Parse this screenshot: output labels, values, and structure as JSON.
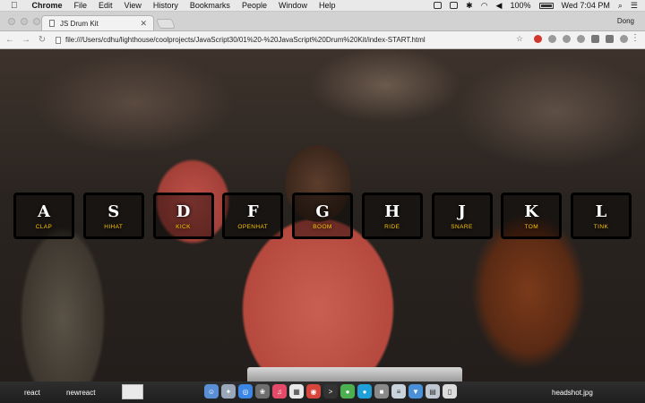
{
  "menubar": {
    "app_name": "Chrome",
    "items": [
      "File",
      "Edit",
      "View",
      "History",
      "Bookmarks",
      "People",
      "Window",
      "Help"
    ],
    "battery": "100%",
    "clock": "Wed 7:04 PM"
  },
  "browser": {
    "tab_title": "JS Drum Kit",
    "profile": "Dong",
    "url": "file:///Users/cdhu/lighthouse/coolprojects/JavaScript30/01%20-%20JavaScript%20Drum%20Kit/index-START.html"
  },
  "drum_keys": [
    {
      "key": "A",
      "sound": "clap"
    },
    {
      "key": "S",
      "sound": "hihat"
    },
    {
      "key": "D",
      "sound": "kick"
    },
    {
      "key": "F",
      "sound": "openhat"
    },
    {
      "key": "G",
      "sound": "boom"
    },
    {
      "key": "H",
      "sound": "ride"
    },
    {
      "key": "J",
      "sound": "snare"
    },
    {
      "key": "K",
      "sound": "tom"
    },
    {
      "key": "L",
      "sound": "tink"
    }
  ],
  "colors": {
    "sound_label": "#ffc600",
    "key_border": "#000000"
  },
  "dock": {
    "left_labels": [
      "react",
      "newreact"
    ],
    "right_label": "headshot.jpg"
  }
}
